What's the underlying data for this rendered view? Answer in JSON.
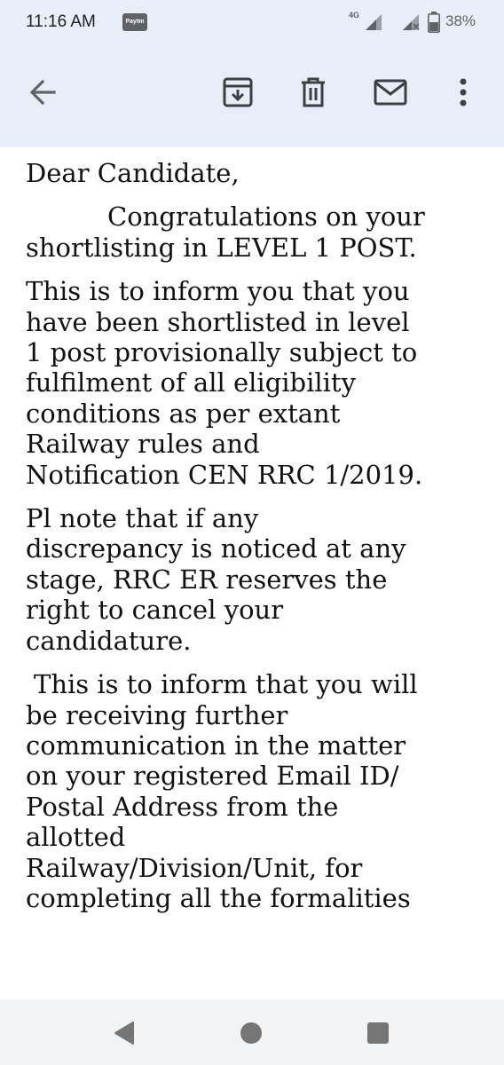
{
  "status_bar": {
    "time": "11:16 AM",
    "paytm_label": "Paytm",
    "network": "4G",
    "battery": "38%"
  },
  "toolbar": {
    "icons": [
      "back-arrow-icon",
      "archive-icon",
      "delete-icon",
      "mark-unread-icon",
      "more-vert-icon"
    ]
  },
  "email": {
    "greeting": "Dear Candidate,",
    "para1": [
      "Congratulations on your",
      "shortlisting  in LEVEL 1 POST."
    ],
    "para2": [
      "This is to inform you that you",
      "have been shortlisted in level",
      "1 post provisionally subject to",
      "fulfilment of all eligibility",
      "conditions as per extant",
      "Railway rules and",
      "Notification CEN RRC 1/2019."
    ],
    "para3": [
      "Pl note that if any",
      "discrepancy is noticed at any",
      "stage, RRC ER reserves the",
      "right to cancel your",
      "candidature."
    ],
    "para4": [
      "This is to inform that you will",
      "be receiving further",
      "communication in the matter",
      "on your registered Email ID/",
      "Postal Address from the",
      "allotted",
      "Railway/Division/Unit, for",
      "completing all the formalities"
    ]
  },
  "navbar": {
    "icons": [
      "back-triangle-icon",
      "home-circle-icon",
      "recents-square-icon"
    ]
  }
}
